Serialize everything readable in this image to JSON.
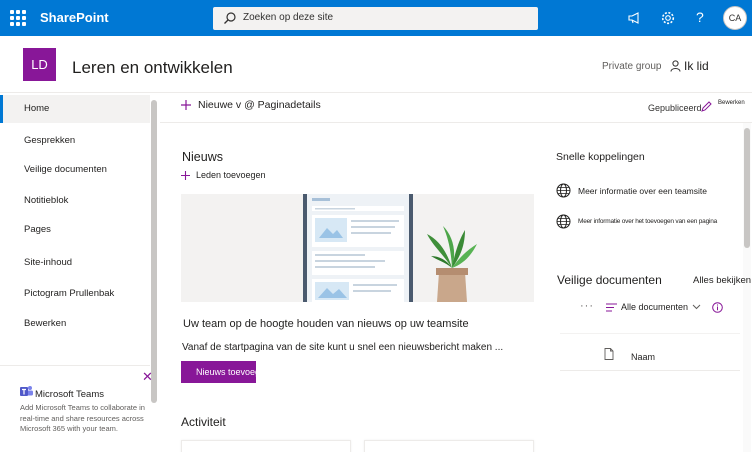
{
  "suite": {
    "brand": "SharePoint",
    "search_placeholder": "Zoeken op deze site",
    "user_initials": "CA",
    "help_label": "?"
  },
  "site": {
    "logo_initials": "LD",
    "title": "Leren en ontwikkelen",
    "privacy": "Private group",
    "join_label": "Ik lid"
  },
  "nav": {
    "items": [
      {
        "label": "Home",
        "selected": true
      },
      {
        "label": "Gesprekken"
      },
      {
        "label": "Veilige documenten"
      },
      {
        "label": "Notitieblok"
      },
      {
        "label": "Pages"
      },
      {
        "label": "Site-inhoud"
      },
      {
        "label": "Pictogram Prullenbak"
      },
      {
        "label": "Bewerken"
      }
    ],
    "teams": {
      "title": "Microsoft Teams",
      "description": "Add Microsoft Teams to collaborate in real-time and share resources across Microsoft 365 with your team."
    }
  },
  "command_bar": {
    "new_label": "Nieuwe v @ Paginadetails",
    "status": "Gepubliceerd",
    "edit_label": "Bewerken"
  },
  "news": {
    "title": "Nieuws",
    "add_label": "Leden toevoegen",
    "headline": "Uw team op de hoogte houden van nieuws op uw teamsite",
    "snippet": "Vanaf de startpagina van de site kunt u snel een nieuwsbericht maken ...",
    "button_label": "Nieuws toevoegen"
  },
  "activity": {
    "title": "Activiteit"
  },
  "quick_links": {
    "title": "Snelle koppelingen",
    "items": [
      {
        "label": "Meer informatie over een teamsite"
      },
      {
        "label": "Meer informatie over het toevoegen van een pagina"
      }
    ]
  },
  "documents": {
    "title": "Veilige documenten",
    "see_all": "Alles bekijken",
    "more": "···",
    "view_label": "Alle documenten",
    "column_name": "Naam"
  },
  "colors": {
    "suite_bar": "#0078d4",
    "site_accent": "#881798"
  },
  "icons": {
    "search": "search-icon",
    "megaphone": "megaphone-icon",
    "settings": "gear-icon",
    "help": "help-icon",
    "person": "person-icon",
    "plus": "plus-icon",
    "pencil": "pencil-icon",
    "globe": "globe-icon",
    "file": "file-icon",
    "info": "info-icon",
    "teams": "teams-icon",
    "close": "close-icon"
  }
}
